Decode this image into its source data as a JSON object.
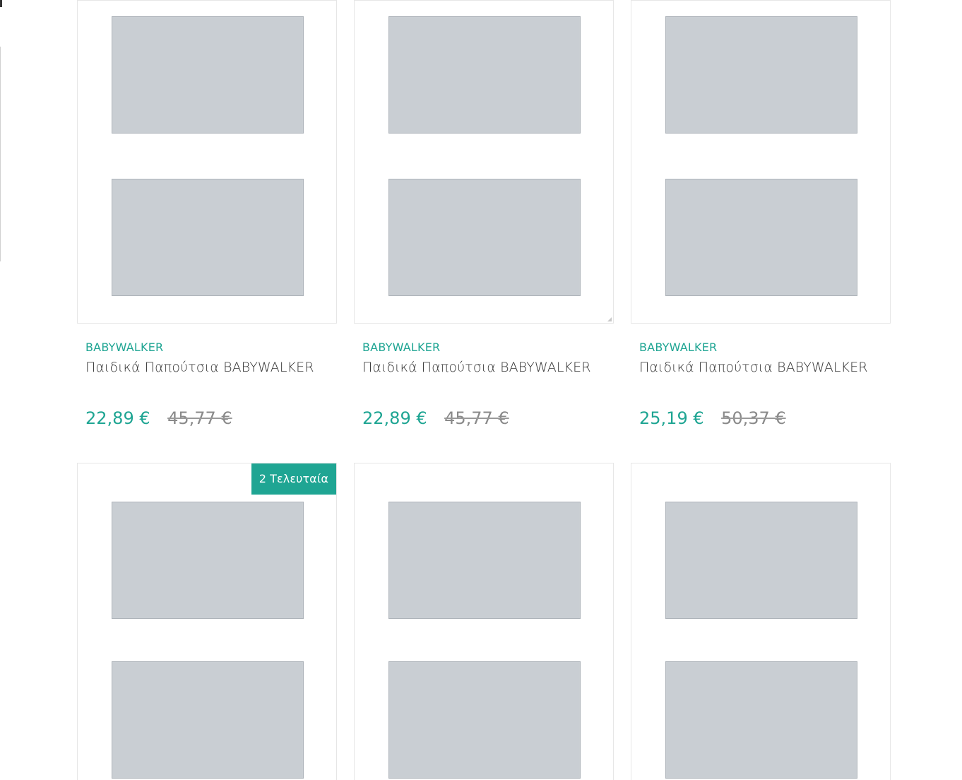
{
  "products": [
    {
      "brand": "BABYWALKER",
      "title": "Παιδικά Παπούτσια BABYWALKER",
      "price": "22,89 €",
      "old_price": "45,77 €"
    },
    {
      "brand": "BABYWALKER",
      "title": "Παιδικά Παπούτσια BABYWALKER",
      "price": "22,89 €",
      "old_price": "45,77 €"
    },
    {
      "brand": "BABYWALKER",
      "title": "Παιδικά Παπούτσια BABYWALKER",
      "price": "25,19 €",
      "old_price": "50,37 €"
    },
    {
      "badge": "2 Τελευταία"
    },
    {},
    {}
  ],
  "colors": {
    "accent": "#1fa593",
    "text": "#333333",
    "old_price": "#8a8a8a",
    "border": "#e6e6e6"
  }
}
